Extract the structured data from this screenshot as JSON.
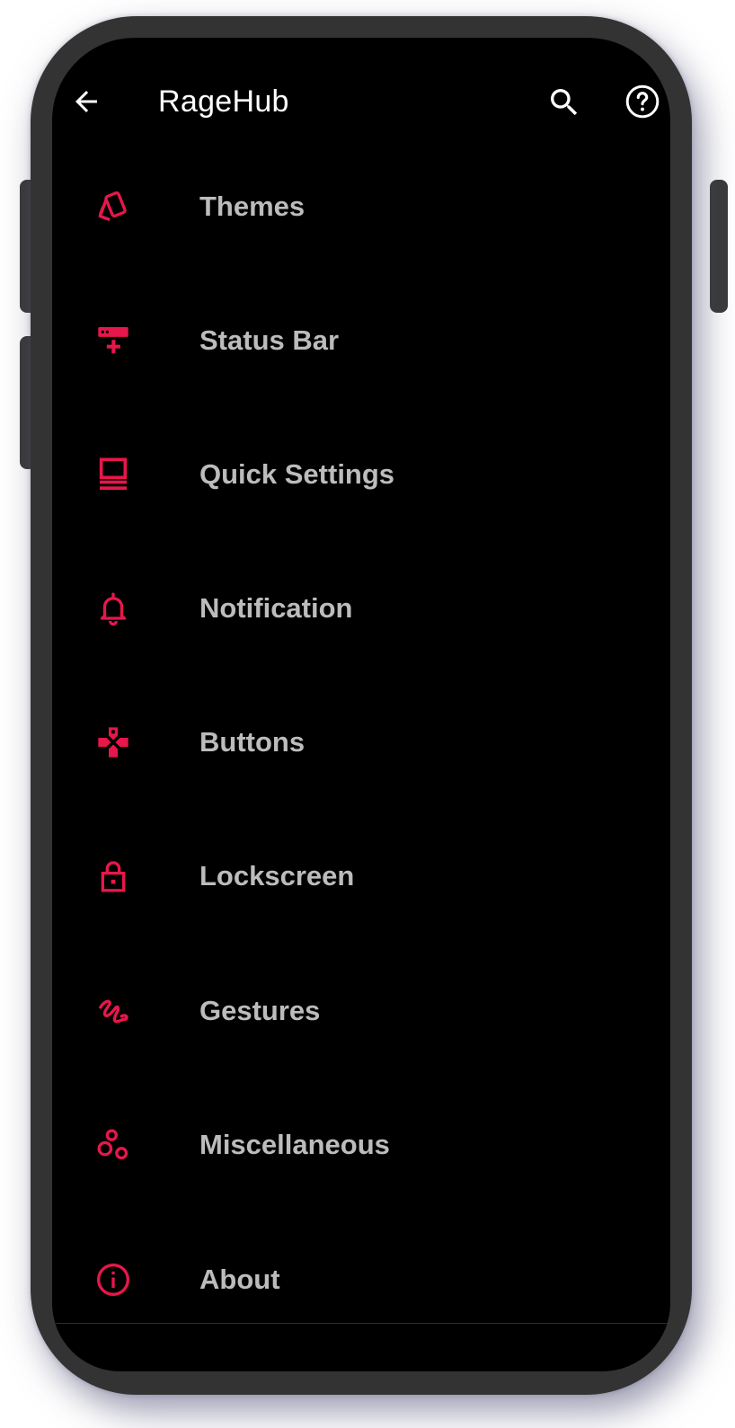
{
  "app_bar": {
    "title": "RageHub",
    "back_icon": "arrow-back-icon",
    "search_icon": "search-icon",
    "help_icon": "help-circle-icon"
  },
  "colors": {
    "accent": "#e6174b",
    "label": "#bcbcbc",
    "background": "#000000",
    "frame": "#333333"
  },
  "menu": {
    "items": [
      {
        "label": "Themes",
        "icon": "cards-icon"
      },
      {
        "label": "Status Bar",
        "icon": "status-bar-add-icon"
      },
      {
        "label": "Quick Settings",
        "icon": "quick-settings-panel-icon"
      },
      {
        "label": "Notification",
        "icon": "bell-icon"
      },
      {
        "label": "Buttons",
        "icon": "gamepad-icon"
      },
      {
        "label": "Lockscreen",
        "icon": "lock-icon"
      },
      {
        "label": "Gestures",
        "icon": "gesture-icon"
      },
      {
        "label": "Miscellaneous",
        "icon": "bubbles-icon"
      },
      {
        "label": "About",
        "icon": "info-icon"
      }
    ]
  }
}
